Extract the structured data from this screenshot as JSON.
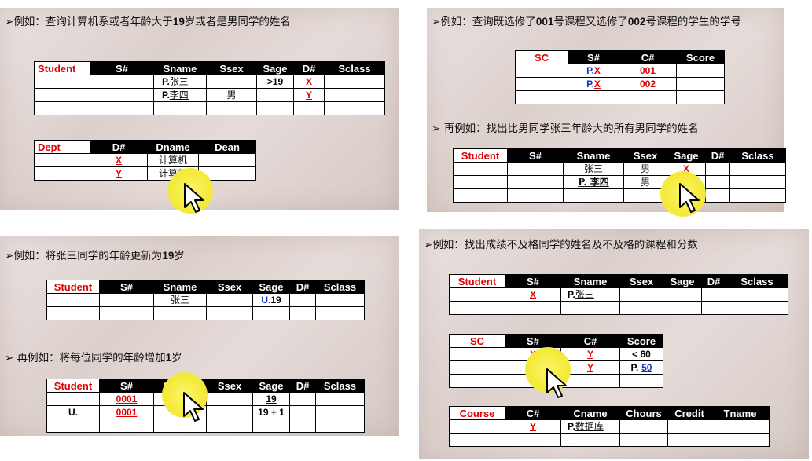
{
  "panels": [
    {
      "heading": "例如：查询计算机系或者年龄大于19岁或者是男同学的姓名",
      "heading_parts": [
        "例如：查询计算机系或者年龄大于",
        "19",
        "岁或者是男同学的姓名"
      ],
      "student": {
        "name": "Student",
        "headers": [
          "S#",
          "Sname",
          "Ssex",
          "Sage",
          "D#",
          "Sclass"
        ],
        "rows": [
          [
            "",
            "P.",
            "张三",
            "",
            ">19",
            "X",
            ""
          ],
          [
            "",
            "P.",
            "李四",
            "男",
            "",
            "Y",
            ""
          ],
          [
            "",
            "",
            "",
            "",
            "",
            "",
            ""
          ]
        ]
      },
      "dept": {
        "name": "Dept",
        "headers": [
          "D#",
          "Dname",
          "Dean"
        ],
        "rows": [
          [
            "X",
            "计算机",
            ""
          ],
          [
            "Y",
            "计算机",
            ""
          ]
        ]
      }
    },
    {
      "heading_parts": [
        "例如：查询既选修了",
        "001",
        "号课程又选修了",
        "002",
        "号课程的学生的学号"
      ],
      "sc": {
        "name": "SC",
        "headers": [
          "S#",
          "C#",
          "Score"
        ],
        "rows": [
          [
            "P.",
            "X",
            "001",
            ""
          ],
          [
            "P.",
            "X",
            "002",
            ""
          ],
          [
            "",
            "",
            "",
            ""
          ]
        ]
      },
      "sub_heading": "再例如：找出比男同学张三年龄大的所有男同学的姓名",
      "student": {
        "name": "Student",
        "headers": [
          "S#",
          "Sname",
          "Ssex",
          "Sage",
          "D#",
          "Sclass"
        ],
        "rows": [
          [
            "",
            "张三",
            "男",
            "X",
            "",
            ""
          ],
          [
            "",
            "P. 李四",
            "男",
            "> X",
            "",
            ""
          ],
          [
            "",
            "",
            "",
            "",
            "",
            ""
          ]
        ]
      }
    },
    {
      "heading_parts": [
        "例如：将张三同学的年龄更新为",
        "19",
        "岁"
      ],
      "student": {
        "name": "Student",
        "headers": [
          "S#",
          "Sname",
          "Ssex",
          "Sage",
          "D#",
          "Sclass"
        ],
        "rows": [
          [
            "",
            "张三",
            "",
            "U.",
            "19",
            "",
            ""
          ],
          [
            "",
            "",
            "",
            "",
            "",
            ""
          ]
        ]
      },
      "sub_heading_parts": [
        "再例如：将每位同学的年龄增加",
        "1",
        "岁"
      ],
      "student2": {
        "name": "Student",
        "headers": [
          "S#",
          "Sname",
          "Ssex",
          "Sage",
          "D#",
          "Sclass"
        ],
        "rows": [
          [
            "",
            "0001",
            "",
            "",
            "19",
            "",
            ""
          ],
          [
            "U.",
            "0001",
            "",
            "",
            "19 + 1",
            "",
            ""
          ],
          [
            "",
            "",
            "",
            "",
            "",
            "",
            ""
          ]
        ]
      }
    },
    {
      "heading": "例如：找出成绩不及格同学的姓名及不及格的课程和分数",
      "student": {
        "name": "Student",
        "headers": [
          "S#",
          "Sname",
          "Ssex",
          "Sage",
          "D#",
          "Sclass"
        ],
        "rows": [
          [
            "X",
            "P.",
            "张三",
            "",
            "",
            "",
            ""
          ],
          [
            "",
            "",
            "",
            "",
            "",
            "",
            ""
          ]
        ]
      },
      "sc": {
        "name": "SC",
        "headers": [
          "S#",
          "C#",
          "Score"
        ],
        "rows": [
          [
            "X",
            "Y",
            "< 60"
          ],
          [
            "X",
            "Y",
            "P.",
            "50"
          ],
          [
            "",
            "",
            ""
          ]
        ]
      },
      "course": {
        "name": "Course",
        "headers": [
          "C#",
          "Cname",
          "Chours",
          "Credit",
          "Tname"
        ],
        "rows": [
          [
            "Y",
            "P.",
            "数据库",
            "",
            "",
            ""
          ],
          [
            "",
            "",
            "",
            "",
            ""
          ]
        ]
      }
    }
  ],
  "bullet": "➢",
  "colors": {
    "red": "#e00000",
    "blue": "#1530c8",
    "highlight": "#f4ea3a"
  },
  "icons": [
    "mouse-pointer-icon",
    "cursor-highlight"
  ]
}
